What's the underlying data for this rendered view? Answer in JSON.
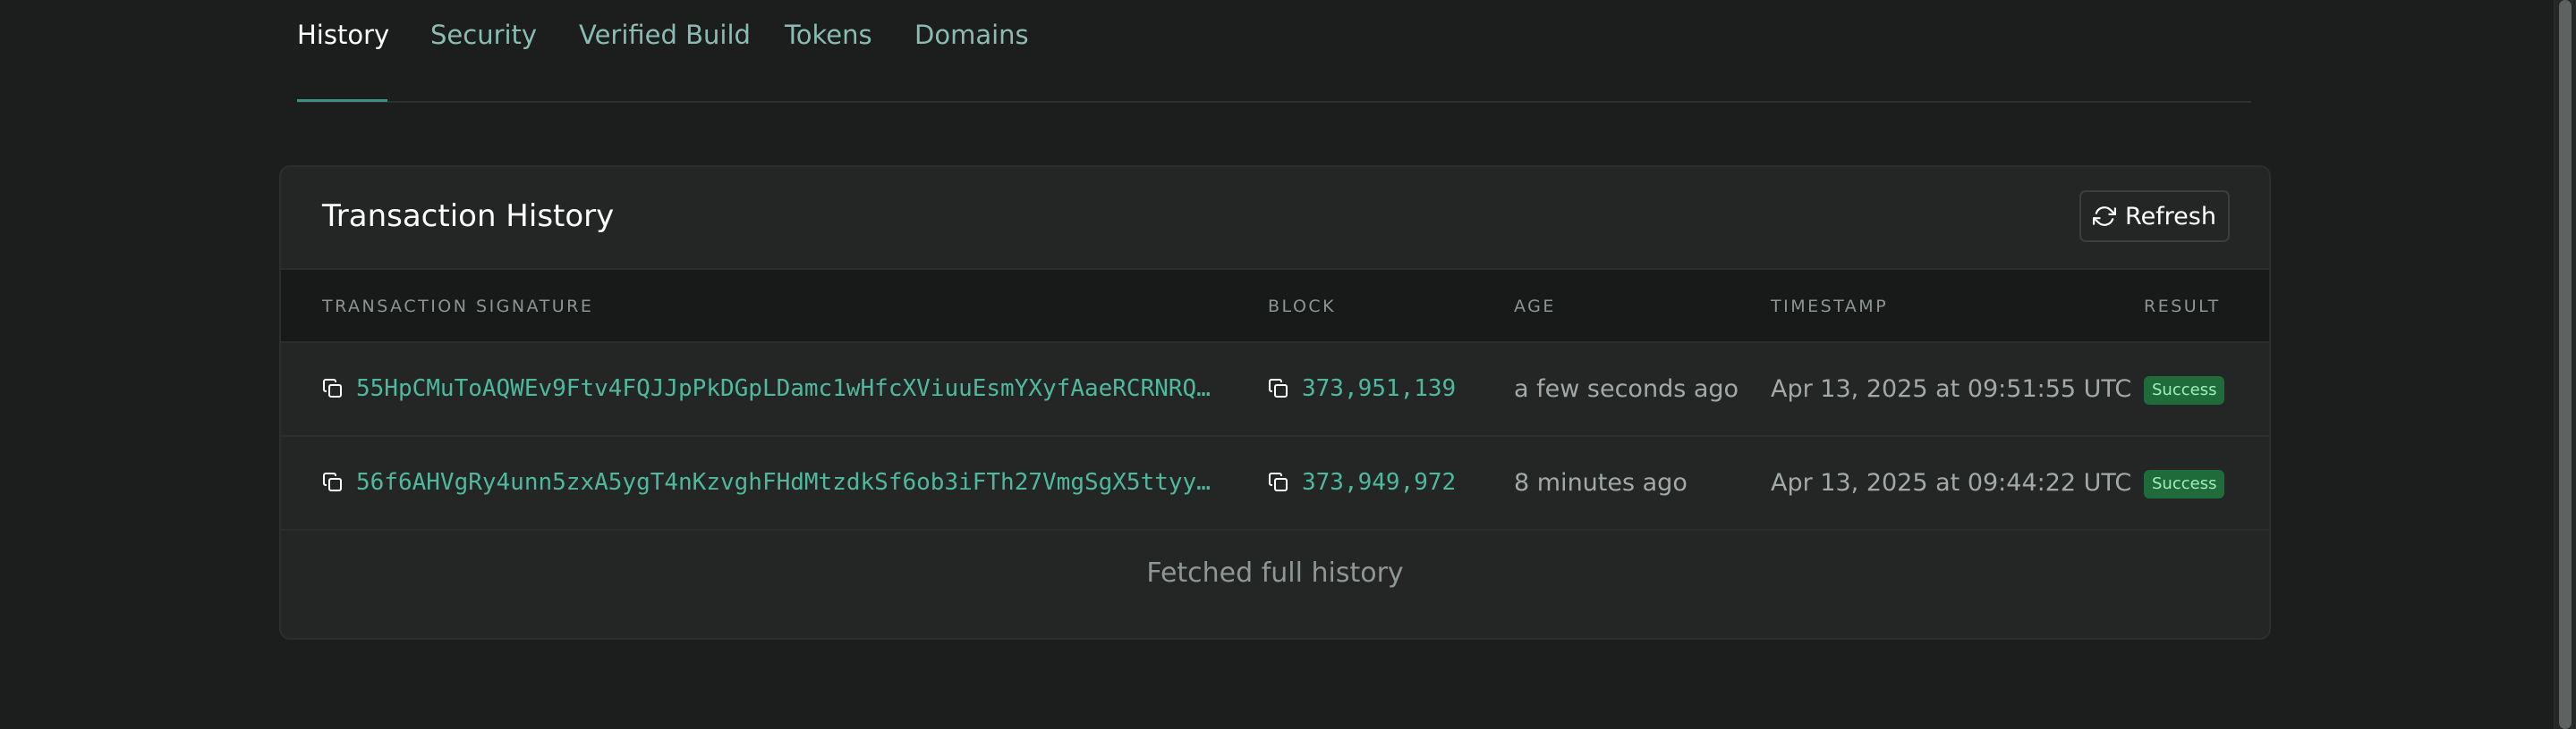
{
  "tabs": [
    {
      "label": "History",
      "active": true
    },
    {
      "label": "Security",
      "active": false
    },
    {
      "label": "Verified Build",
      "active": false
    },
    {
      "label": "Tokens",
      "active": false
    },
    {
      "label": "Domains",
      "active": false
    }
  ],
  "card": {
    "title": "Transaction History",
    "refresh_label": "Refresh"
  },
  "table": {
    "columns": [
      "TRANSACTION SIGNATURE",
      "BLOCK",
      "AGE",
      "TIMESTAMP",
      "RESULT"
    ],
    "rows": [
      {
        "signature": "55HpCMuToAQWEv9Ftv4FQJJpPkDGpLDamc1wHfcXViuuEsmYXyfAaeRCRNRQ…",
        "block": "373,951,139",
        "age": "a few seconds ago",
        "timestamp": "Apr 13, 2025 at 09:51:55 UTC",
        "result": "Success"
      },
      {
        "signature": "56f6AHVgRy4unn5zxA5ygT4nKzvghFHdMtzdkSf6ob3iFTh27VmgSgX5ttyy…",
        "block": "373,949,972",
        "age": "8 minutes ago",
        "timestamp": "Apr 13, 2025 at 09:44:22 UTC",
        "result": "Success"
      }
    ]
  },
  "footer": {
    "text": "Fetched full history"
  },
  "icons": {
    "copy": "copy-icon",
    "refresh": "refresh-icon"
  },
  "colors": {
    "accent": "#4fb99f",
    "active_tab_underline": "#3d8f7f",
    "success_bg": "#1f6b3a",
    "success_text": "#9ff0b7",
    "background": "#1c1e1d"
  }
}
